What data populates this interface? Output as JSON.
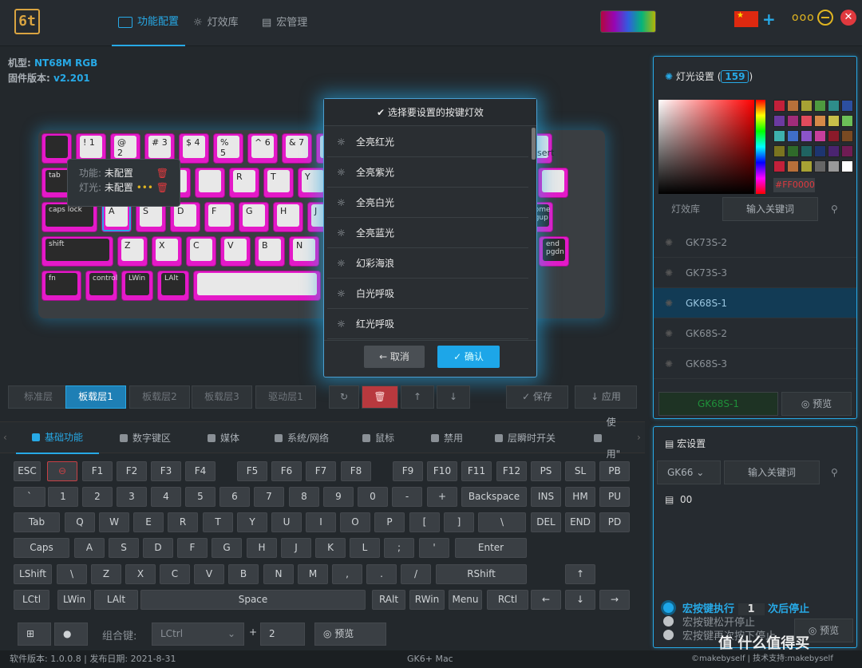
{
  "header": {
    "logo": "6t",
    "tabs": [
      {
        "label": "功能配置",
        "icon": "keyboard-icon"
      },
      {
        "label": "灯效库",
        "icon": "sun-icon"
      },
      {
        "label": "宏管理",
        "icon": "document-icon"
      }
    ],
    "flag": "★",
    "plus": "+",
    "more": "ooo",
    "close": "✕"
  },
  "device": {
    "model_label": "机型:",
    "model": "NT68M RGB",
    "fw_label": "固件版本:",
    "fw": "v2.201"
  },
  "keyboard": {
    "rows": [
      [
        "",
        "! 1",
        "@ 2",
        "# 3",
        "$ 4",
        "% 5",
        "^ 6",
        "& 7",
        "",
        "",
        "",
        "",
        "",
        "← delete",
        "fn insert"
      ],
      [
        "tab",
        "",
        "",
        "",
        "",
        "R",
        "T",
        "Y",
        "U",
        "",
        "",
        "",
        "",
        "",
        ""
      ],
      [
        "caps lock",
        "A",
        "S",
        "D",
        "F",
        "G",
        "H",
        "J",
        "",
        "",
        "",
        "",
        "enter return",
        "home pgup"
      ],
      [
        "shift",
        "Z",
        "X",
        "C",
        "V",
        "B",
        "N",
        "",
        "",
        "",
        "",
        "",
        "",
        "end pgdn"
      ],
      [
        "fn",
        "control",
        "LWin",
        "LAlt",
        "",
        "",
        "",
        "",
        "",
        ""
      ]
    ]
  },
  "tooltip": {
    "func_label": "功能:",
    "func_val": "未配置",
    "light_label": "灯光:",
    "light_val": "未配置",
    "dots": "•••"
  },
  "modal": {
    "title": "选择要设置的按键灯效",
    "items": [
      "全亮红光",
      "全亮紫光",
      "全亮白光",
      "全亮蓝光",
      "幻彩海浪",
      "白光呼吸",
      "红光呼吸"
    ],
    "cancel": "← 取消",
    "ok": "✓ 确认"
  },
  "layers": {
    "tabs": [
      "标准层",
      "板载层1",
      "板载层2",
      "板载层3",
      "驱动层1"
    ],
    "active": 1,
    "save": "✓ 保存",
    "apply": "↓ 应用",
    "tools": [
      "↻",
      "🗑",
      "↑",
      "↓"
    ]
  },
  "functabs": {
    "items": [
      "基础功能",
      "数字键区",
      "媒体",
      "系统/网络",
      "鼠标",
      "禁用",
      "层瞬时开关",
      "使用\""
    ],
    "active": 0
  },
  "vkeys": [
    [
      "ESC",
      "",
      "F1",
      "F2",
      "F3",
      "F4",
      "F5",
      "F6",
      "F7",
      "F8",
      "F9",
      "F10",
      "F11",
      "F12",
      "PS",
      "SL",
      "PB"
    ],
    [
      "`",
      "1",
      "2",
      "3",
      "4",
      "5",
      "6",
      "7",
      "8",
      "9",
      "0",
      "-",
      "+",
      "Backspace",
      "INS",
      "HM",
      "PU"
    ],
    [
      "Tab",
      "Q",
      "W",
      "E",
      "R",
      "T",
      "Y",
      "U",
      "I",
      "O",
      "P",
      "[",
      "]",
      "\\",
      "DEL",
      "END",
      "PD"
    ],
    [
      "Caps",
      "A",
      "S",
      "D",
      "F",
      "G",
      "H",
      "J",
      "K",
      "L",
      ";",
      "'",
      "Enter"
    ],
    [
      "LShift",
      "\\",
      "Z",
      "X",
      "C",
      "V",
      "B",
      "N",
      "M",
      ",",
      ".",
      "/",
      "RShift",
      "↑"
    ],
    [
      "LCtl",
      "LWin",
      "LAlt",
      "Space",
      "RAlt",
      "RWin",
      "Menu",
      "RCtl",
      "←",
      "↓",
      "→"
    ]
  ],
  "combo": {
    "label": "组合键:",
    "key": "LCtrl",
    "plus": "+",
    "count": "2",
    "preview": "◎ 预览"
  },
  "status": {
    "version": "软件版本: 1.0.0.8 | 发布日期: 2021-8-31",
    "app": "GK6+ Mac",
    "credit": "©makebyself | 技术支持:makebyself"
  },
  "light": {
    "title": "灯光设置 (",
    "count": "159",
    "close": ")",
    "hex": "#FF0000",
    "tab_lib": "灯效库",
    "search_placeholder": "输入关键词",
    "items": [
      "GK73S-2",
      "GK73S-3",
      "GK68S-1",
      "GK68S-2",
      "GK68S-3"
    ],
    "selected": 2,
    "current": "GK68S-1",
    "preview": "◎ 预览"
  },
  "macro": {
    "title": "宏设置",
    "select": "GK66",
    "search_placeholder": "输入关键词",
    "file": "00",
    "opt1": "宏按键执行",
    "opt1_count": "1",
    "opt1_tail": "次后停止",
    "opt2": "宏按键松开停止",
    "opt3": "宏按键再次按下停止",
    "preview": "◎ 预览"
  },
  "watermark": "值 什么值得买",
  "colors": {
    "accent": "#27a9e6",
    "key": "#e419c8",
    "danger": "#e0393e"
  }
}
